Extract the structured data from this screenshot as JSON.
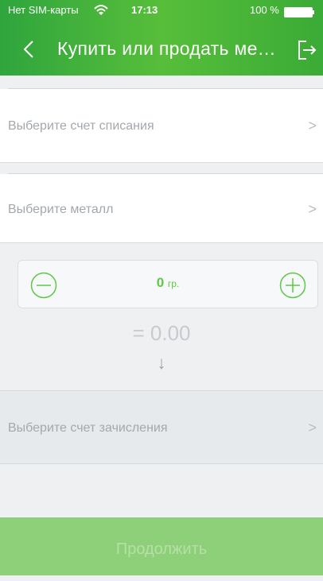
{
  "status_bar": {
    "carrier": "Нет SIM-карты",
    "time": "17:13",
    "battery": "100 %",
    "icons": [
      "wifi-icon",
      "battery-icon"
    ]
  },
  "nav": {
    "title": "Купить или продать ме…",
    "back_icon": "back-arrow-icon",
    "exit_icon": "logout-icon"
  },
  "debit_account": {
    "placeholder": "Выберите счет списания",
    "chevron": ">"
  },
  "metal": {
    "placeholder": "Выберите металл",
    "chevron": ">"
  },
  "amount": {
    "value": "0",
    "unit": "гр.",
    "minus_icon": "minus-circle-icon",
    "plus_icon": "plus-circle-icon"
  },
  "result": {
    "text": "= 0.00",
    "arrow": "↓"
  },
  "credit_account": {
    "placeholder": "Выберите счет зачисления",
    "chevron": ">"
  },
  "footer": {
    "continue_label": "Продолжить"
  },
  "colors": {
    "accent": "#4cb83c",
    "button_disabled": "#8ecf79"
  }
}
